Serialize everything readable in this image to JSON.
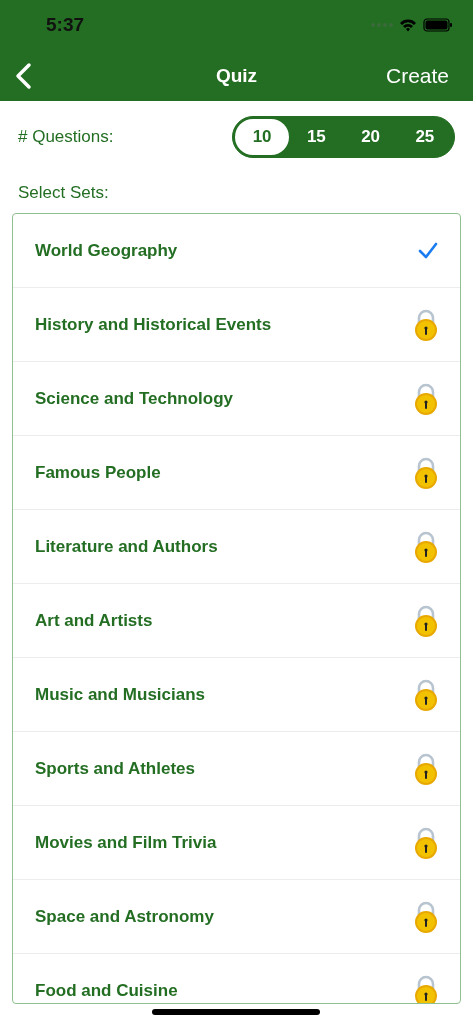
{
  "status_bar": {
    "time": "5:37"
  },
  "nav": {
    "title": "Quiz",
    "action": "Create"
  },
  "questions": {
    "label": "# Questions:",
    "options": [
      {
        "label": "10",
        "selected": true
      },
      {
        "label": "15",
        "selected": false
      },
      {
        "label": "20",
        "selected": false
      },
      {
        "label": "25",
        "selected": false
      }
    ]
  },
  "sets": {
    "label": "Select Sets:",
    "items": [
      {
        "name": "World Geography",
        "selected": true,
        "locked": false
      },
      {
        "name": "History and Historical Events",
        "selected": false,
        "locked": true
      },
      {
        "name": "Science and Technology",
        "selected": false,
        "locked": true
      },
      {
        "name": "Famous People",
        "selected": false,
        "locked": true
      },
      {
        "name": "Literature and Authors",
        "selected": false,
        "locked": true
      },
      {
        "name": "Art and Artists",
        "selected": false,
        "locked": true
      },
      {
        "name": "Music and Musicians",
        "selected": false,
        "locked": true
      },
      {
        "name": "Sports and Athletes",
        "selected": false,
        "locked": true
      },
      {
        "name": "Movies and Film Trivia",
        "selected": false,
        "locked": true
      },
      {
        "name": "Space and Astronomy",
        "selected": false,
        "locked": true
      },
      {
        "name": "Food and Cuisine",
        "selected": false,
        "locked": true
      }
    ]
  }
}
